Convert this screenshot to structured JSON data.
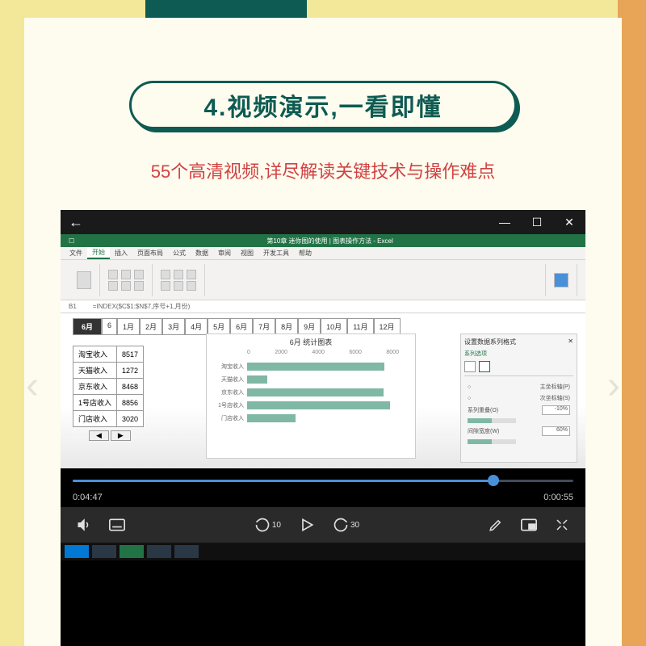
{
  "banner": {
    "title": "4.视频演示,一看即懂",
    "subtitle": "55个高清视频,详尽解读关键技术与操作难点"
  },
  "player": {
    "win_minimize": "—",
    "win_maximize": "☐",
    "win_close": "✕",
    "current_time": "0:04:47",
    "remaining_time": "0:00:55",
    "skip_back": "10",
    "skip_fwd": "30"
  },
  "excel": {
    "app_title": "第10章 迷你图的使用 | 图表操作方法 - Excel",
    "tabs": [
      "文件",
      "开始",
      "插入",
      "页面布局",
      "公式",
      "数据",
      "审阅",
      "视图",
      "开发工具",
      "帮助"
    ],
    "active_tab": "开始",
    "formula_ref": "=INDEX($C$1:$N$7,序号+1,月份)",
    "month_selected": "6月",
    "months": [
      "6",
      "1月",
      "2月",
      "3月",
      "4月",
      "5月",
      "6月",
      "7月",
      "8月",
      "9月",
      "10月",
      "11月",
      "12月"
    ],
    "table": [
      {
        "label": "淘宝收入",
        "value": 8517
      },
      {
        "label": "天猫收入",
        "value": 1272
      },
      {
        "label": "京东收入",
        "value": 8468
      },
      {
        "label": "1号店收入",
        "value": 8856
      },
      {
        "label": "门店收入",
        "value": 3020
      }
    ],
    "scroll_left": "◀",
    "scroll_right": "▶",
    "chart_title": "6月     统计图表",
    "chart_axis": [
      "0",
      "2000",
      "4000",
      "6000",
      "8000"
    ],
    "format_panel": {
      "title": "设置数据系列格式",
      "close": "✕",
      "section": "系列选项",
      "rows": [
        {
          "label": "系列重叠(O)",
          "value": "-10%"
        },
        {
          "label": "间隙宽度(W)",
          "value": "60%"
        }
      ],
      "radio1": "主坐标轴(P)",
      "radio2": "次坐标轴(S)"
    }
  },
  "chart_data": {
    "type": "bar",
    "title": "6月 统计图表",
    "xlabel": "",
    "ylabel": "",
    "xlim": [
      0,
      10000
    ],
    "categories": [
      "淘宝收入",
      "天猫收入",
      "京东收入",
      "1号店收入",
      "门店收入"
    ],
    "values": [
      8517,
      1272,
      8468,
      8856,
      3020
    ]
  }
}
